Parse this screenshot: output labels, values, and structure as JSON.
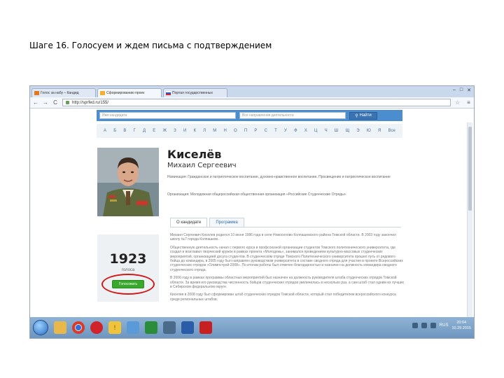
{
  "slide": {
    "title": "Шаге 16. Голосуем и ждем письма с подтверждением"
  },
  "browser": {
    "tabs": [
      {
        "label": "Голос за набу – Кандид"
      },
      {
        "label": "Сформированию проек"
      },
      {
        "label": "Портал государственных"
      }
    ],
    "window_buttons": {
      "minimize": "–",
      "maximize": "□",
      "close": "✕"
    },
    "nav": {
      "back": "←",
      "forward": "→",
      "reload": "C",
      "home": "⌂",
      "star": "☆",
      "menu": "≡"
    },
    "url": "http://sprfed.ru/155/"
  },
  "page": {
    "search": {
      "name_placeholder": "Имя кандидата",
      "direction_placeholder": "Все направления деятельности",
      "button_label": "Найти"
    },
    "alphabet": [
      "А",
      "Б",
      "В",
      "Г",
      "Д",
      "Е",
      "Ж",
      "З",
      "И",
      "К",
      "Л",
      "М",
      "Н",
      "О",
      "П",
      "Р",
      "С",
      "Т",
      "У",
      "Ф",
      "Х",
      "Ц",
      "Ч",
      "Ш",
      "Щ",
      "Э",
      "Ю",
      "Я",
      "Все"
    ],
    "candidate": {
      "surname": "Киселёв",
      "given_names": "Михаил Сергеевич",
      "nomination": "Номинация: Гражданское и патриотическое воспитание, духовно-нравственное воспитание. Просвещение и патриотическое воспитание",
      "organization": "Организация: Молодежная общероссийская общественная организация «Российские Студенческие Отряды»"
    },
    "tabs": [
      {
        "label": "О кандидате"
      },
      {
        "label": "Программа"
      }
    ],
    "votes": {
      "count": "1923",
      "label": "голоса",
      "button_label": "Голосовать"
    },
    "bio": [
      "Михаил Сергеевич Киселев родился 10 июня 1986 года в селе Новоселово Колпашевского района Томской области. В 2003 году закончил школу №7 города Колпашево.",
      "Общественную деятельность начал с первого курса в профсоюзной организации студентов Томского политехнического университета, где создал и возглавил творческий кружок в рамках проекта «Молодежь», занимался проведением культурно-массовых студенческих мероприятий, организацией досуга студентов. В студенческом отряде Томского Политехнического университета прошел путь от рядового бойца до командира, в 2005 году был направлен руководством университета в составе сводного отряда для участия в проекте Всероссийских студенческих отрядов «Олимпстрой-2008». По итогам работы был отмечен благодарностью и назначен на должность командира сводного студенческого отряда.",
      "В 2006 году в рамках программы областных мероприятий был назначен на должность руководителя штаба студенческих отрядов Томской области. За время его руководства численность бойцов студенческих отрядов увеличилась в несколько раз, а сам штаб стал одним из лучших в Сибирском федеральном округе.",
      "Киселев в 2008 году был сформирован штаб студенческих отрядов Томской области, который стал победителем всероссийского конкурса среди региональных штабов."
    ],
    "status": "https://sprfed.ru/155/"
  },
  "taskbar": {
    "language": "RUS",
    "time": "20:04",
    "date": "10.29.2015"
  }
}
